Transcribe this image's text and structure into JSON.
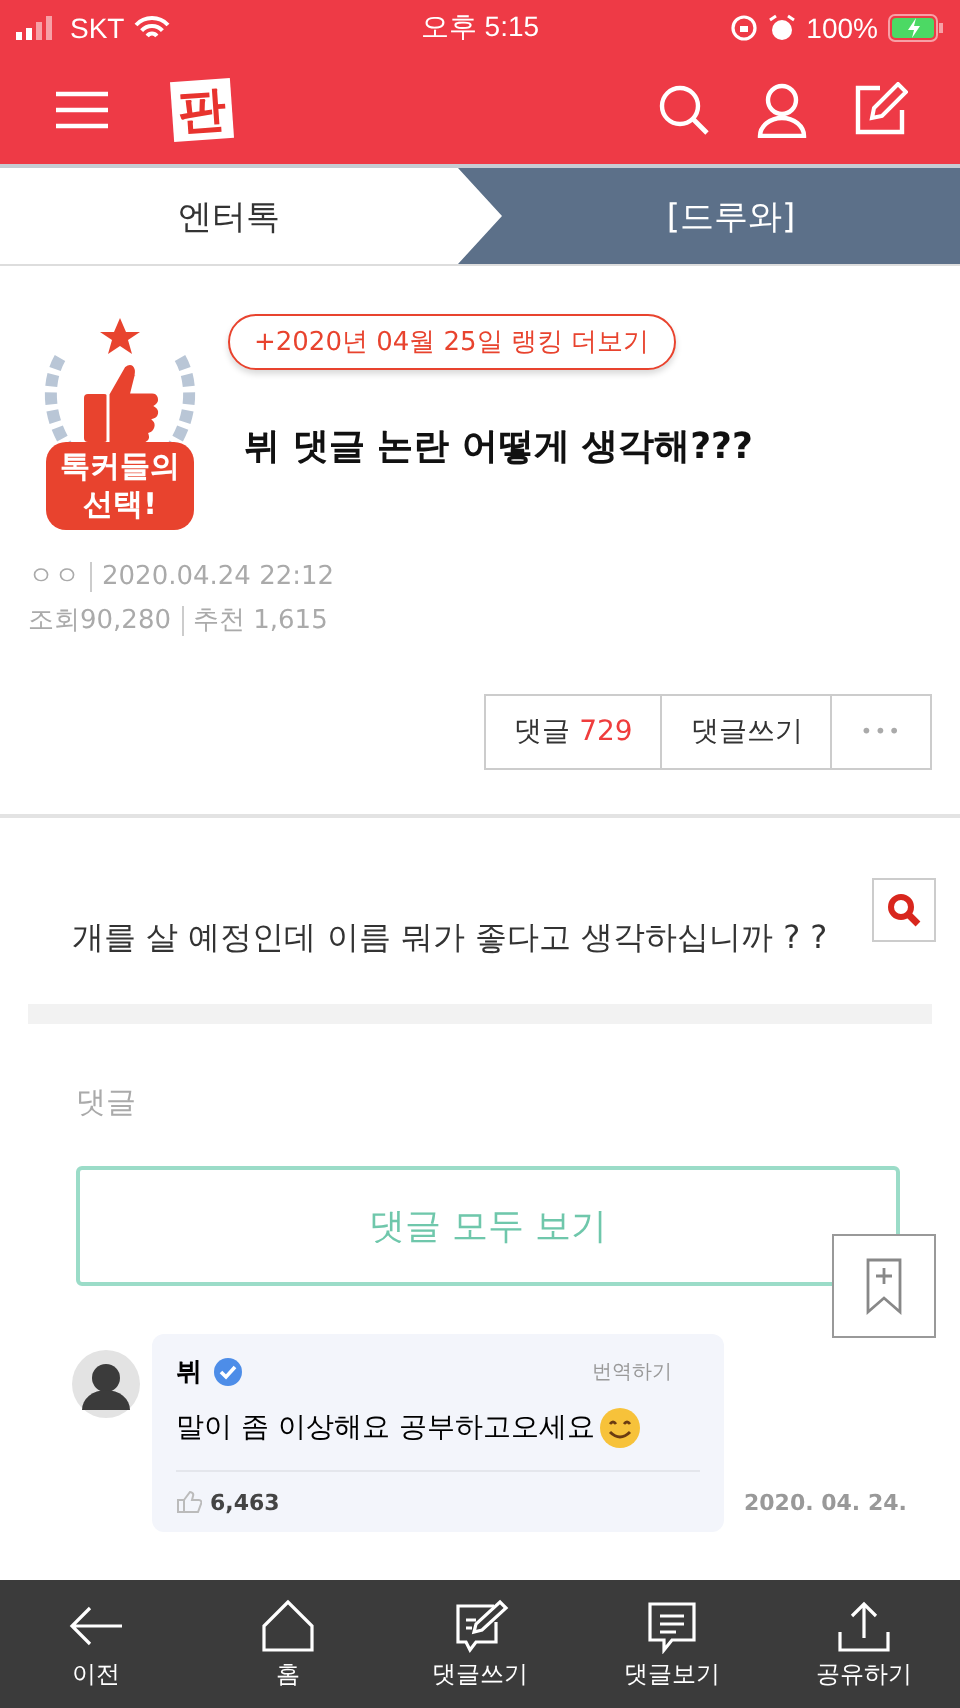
{
  "status_bar": {
    "carrier": "SKT",
    "time": "오후 5:15",
    "battery": "100%"
  },
  "header": {
    "logo": "판"
  },
  "tabs": [
    {
      "label": "엔터톡",
      "selected": true
    },
    {
      "label": "[드루와]",
      "selected": false
    }
  ],
  "post": {
    "ranking_link": "+2020년 04월 25일 랭킹 더보기",
    "badge": "톡커들의 선택!",
    "title": "뷔 댓글 논란 어떻게 생각해???",
    "author": "ㅇㅇ",
    "date": "2020.04.24 22:12",
    "views_label": "조회",
    "views": "90,280",
    "likes_label": "추천",
    "likes": "1,615"
  },
  "actions": {
    "comments_label": "댓글",
    "comments_count": "729",
    "write": "댓글쓰기",
    "more": "•••"
  },
  "body": {
    "question": "개를 살 예정인데 이름 뭐가 좋다고 생각하십니까 ? ?",
    "comments_heading": "댓글",
    "view_all": "댓글 모두 보기"
  },
  "embedded_comment": {
    "name": "뷔",
    "translate": "번역하기",
    "text": "말이 좀 이상해요 공부하고오세요",
    "likes": "6,463",
    "date": "2020. 04. 24."
  },
  "bottom_nav": [
    {
      "label": "이전",
      "kind": "back"
    },
    {
      "label": "홈",
      "kind": "home"
    },
    {
      "label": "댓글쓰기",
      "kind": "write"
    },
    {
      "label": "댓글보기",
      "kind": "comments"
    },
    {
      "label": "공유하기",
      "kind": "share"
    }
  ]
}
